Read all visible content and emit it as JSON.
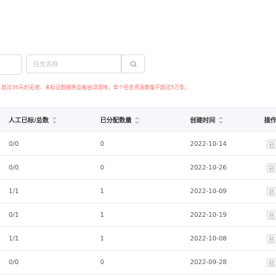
{
  "toolbar": {
    "search_placeholder": "任务名称",
    "notice": "超过30天的无效、未标记数据将会被自动清除，单个任务资源数量不超过5万条。"
  },
  "table": {
    "columns": [
      "人工已标/总数",
      "已分配数量",
      "创建时间",
      "操作"
    ],
    "rows": [
      {
        "labeled": "0/0",
        "assigned": "0",
        "created": "2022-10-14",
        "action": "已"
      },
      {
        "labeled": "0/0",
        "assigned": "0",
        "created": "2022-10-26",
        "action": "已"
      },
      {
        "labeled": "1/1",
        "assigned": "1",
        "created": "2022-10-09",
        "action": "已"
      },
      {
        "labeled": "0/1",
        "assigned": "1",
        "created": "2022-10-19",
        "action": "已"
      },
      {
        "labeled": "1/1",
        "assigned": "1",
        "created": "2022-10-08",
        "action": "已"
      },
      {
        "labeled": "0/0",
        "assigned": "0",
        "created": "2022-09-28",
        "action": "已"
      }
    ]
  }
}
